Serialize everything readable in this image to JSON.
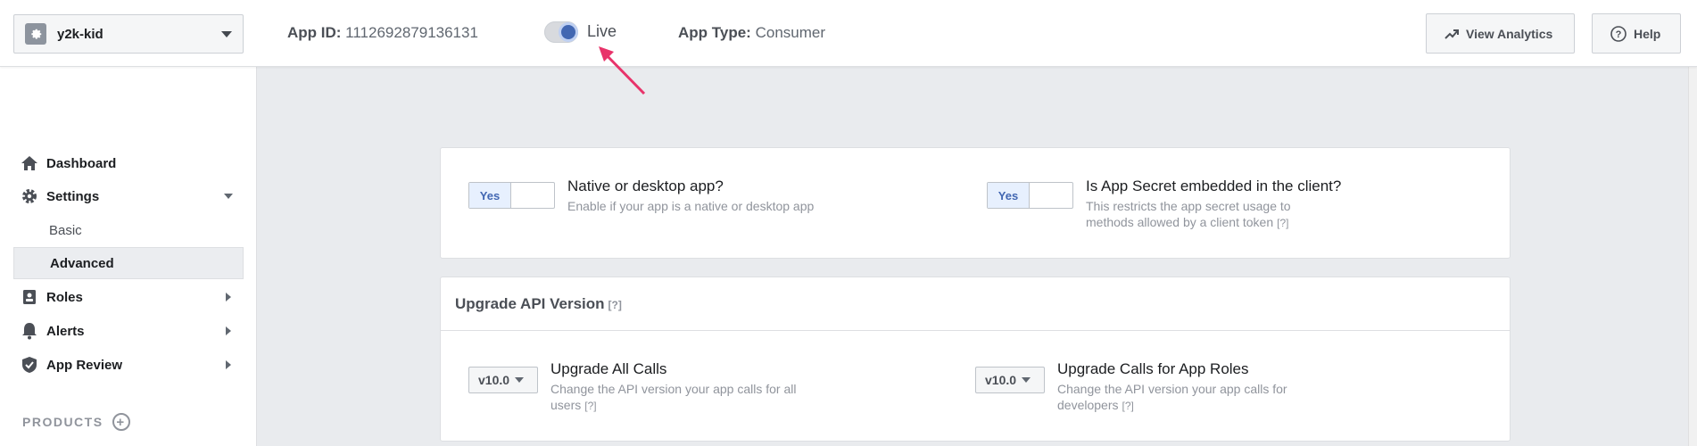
{
  "header": {
    "app_name": "y2k-kid",
    "app_id_label": "App ID:",
    "app_id_value": "1112692879136131",
    "live_label": "Live",
    "app_type_label": "App Type:",
    "app_type_value": "Consumer",
    "view_analytics_label": "View Analytics",
    "help_label": "Help"
  },
  "sidebar": {
    "dashboard": "Dashboard",
    "settings": "Settings",
    "basic": "Basic",
    "advanced": "Advanced",
    "roles": "Roles",
    "alerts": "Alerts",
    "app_review": "App Review",
    "products": "PRODUCTS"
  },
  "settings_card": {
    "native": {
      "toggle": "Yes",
      "title": "Native or desktop app?",
      "desc": "Enable if your app is a native or desktop app"
    },
    "secret": {
      "toggle": "Yes",
      "title": "Is App Secret embedded in the client?",
      "desc_line1": "This restricts the app secret usage to",
      "desc_line2": "methods allowed by a client token",
      "help": "[?]"
    }
  },
  "upgrade_card": {
    "title": "Upgrade API Version",
    "help": "[?]",
    "all_calls": {
      "version": "v10.0",
      "title": "Upgrade All Calls",
      "desc_line1": "Change the API version your app calls for all",
      "desc_line2": "users",
      "help": "[?]"
    },
    "app_roles": {
      "version": "v10.0",
      "title": "Upgrade Calls for App Roles",
      "desc_line1": "Change the API version your app calls for",
      "desc_line2": "developers",
      "help": "[?]"
    }
  },
  "colors": {
    "accent": "#4267b2",
    "arrow": "#e8336a",
    "background": "#e9ebee"
  }
}
